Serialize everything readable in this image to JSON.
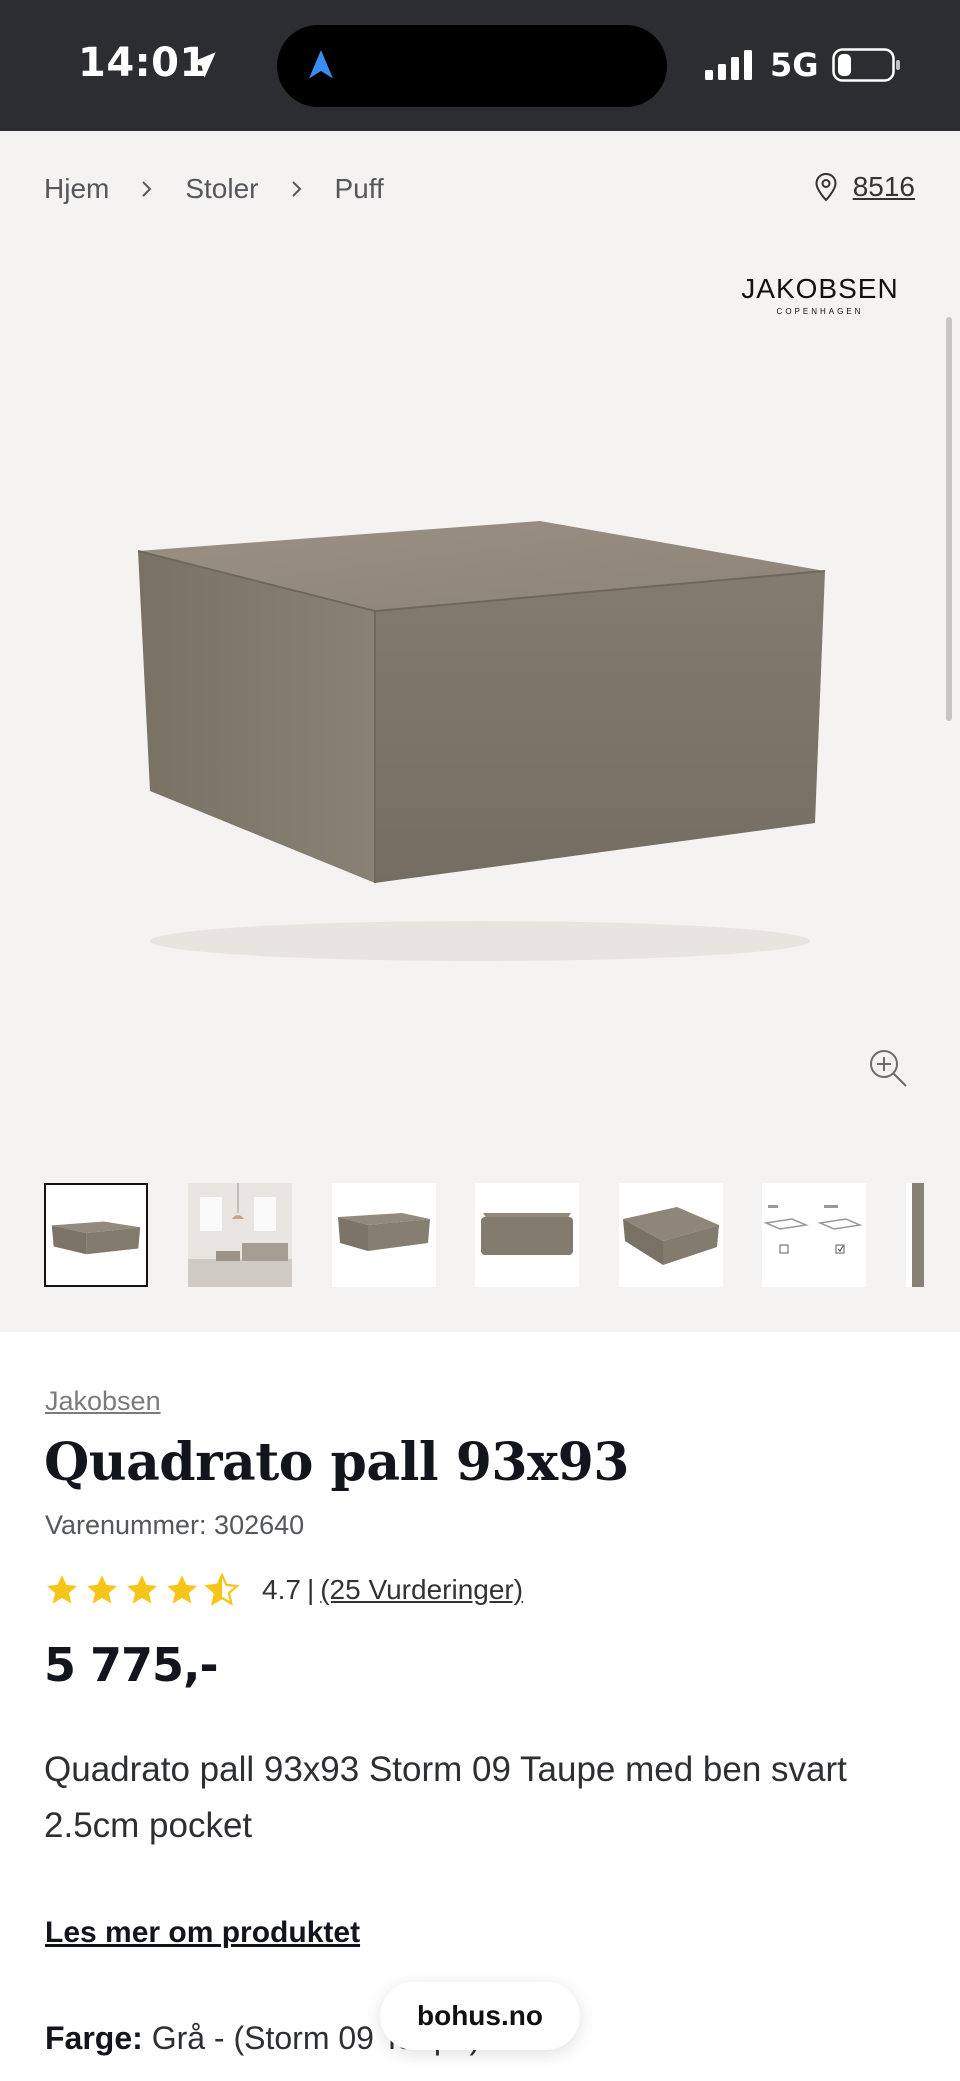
{
  "status_bar": {
    "time": "14:01",
    "network": "5G"
  },
  "breadcrumb": {
    "items": [
      "Hjem",
      "Stoler",
      "Puff"
    ]
  },
  "store": {
    "id": "8516"
  },
  "brand_logo": {
    "name": "JAKOBSEN",
    "sub": "COPENHAGEN"
  },
  "product": {
    "brand": "Jakobsen",
    "title": "Quadrato pall 93x93",
    "sku": "Varenummer: 302640",
    "rating_value": "4.7",
    "rating_separator": "|",
    "reviews": "(25 Vurderinger)",
    "stars": 4.5,
    "price": "5 775,-",
    "description": "Quadrato pall 93x93 Storm 09 Taupe med ben svart 2.5cm pocket",
    "read_more": "Les mer om produktet",
    "color_label": "Farge:",
    "color_value": "Grå - (Storm 09 Taupe)"
  },
  "thumbnails": [
    "pouf-front",
    "room-scene",
    "pouf-side",
    "pouf-low",
    "pouf-top",
    "feature-diagram",
    "fabric-swatch"
  ],
  "domain_pill": "bohus.no",
  "colors": {
    "accent_star": "#f5c518",
    "gallery_bg": "#f5f3f1",
    "status_bar_bg": "#2c2d30"
  }
}
